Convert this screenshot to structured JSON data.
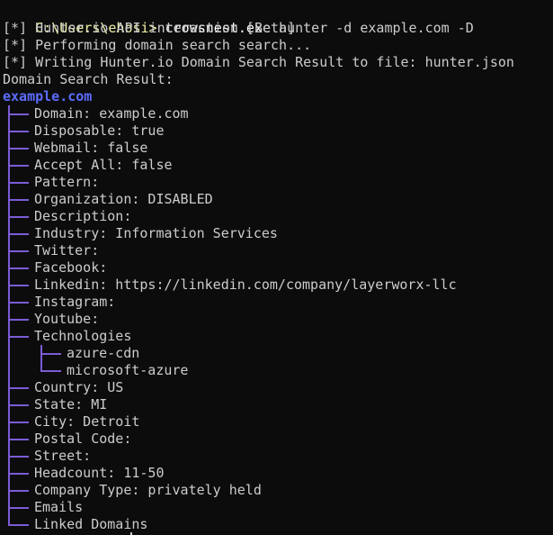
{
  "prompt": {
    "path": "C:\\Users\\ehosi>",
    "command": "crowsnest.exe",
    "args": "hunter -d example.com -D"
  },
  "log_lines": [
    "[*] Hunter.io API interaction [Beta]",
    "[*] Performing domain search search...",
    "[*] Writing Hunter.io Domain Search Result to file: hunter.json"
  ],
  "result_heading": "Domain Search Result:",
  "root": "example.com",
  "tree": [
    "Domain: example.com",
    "Disposable: true",
    "Webmail: false",
    "Accept All: false",
    "Pattern:",
    "Organization: DISABLED",
    "Description:",
    "Industry: Information Services",
    "Twitter:",
    "Facebook:",
    "Linkedin: https://linkedin.com/company/layerworx-llc",
    "Instagram:",
    "Youtube:",
    "Technologies"
  ],
  "technologies": [
    "azure-cdn",
    "microsoft-azure"
  ],
  "tree_after": [
    "Country: US",
    "State: MI",
    "City: Detroit",
    "Postal Code:",
    "Street:",
    "Headcount: 11-50",
    "Company Type: privately held",
    "Emails",
    "Linked Domains"
  ],
  "colors": {
    "background": "#0c0c0c",
    "text": "#cccccc",
    "prompt_path": "#f2f2a8",
    "root_label": "#5c6cff",
    "tree_branch": "#7b5cd6"
  }
}
